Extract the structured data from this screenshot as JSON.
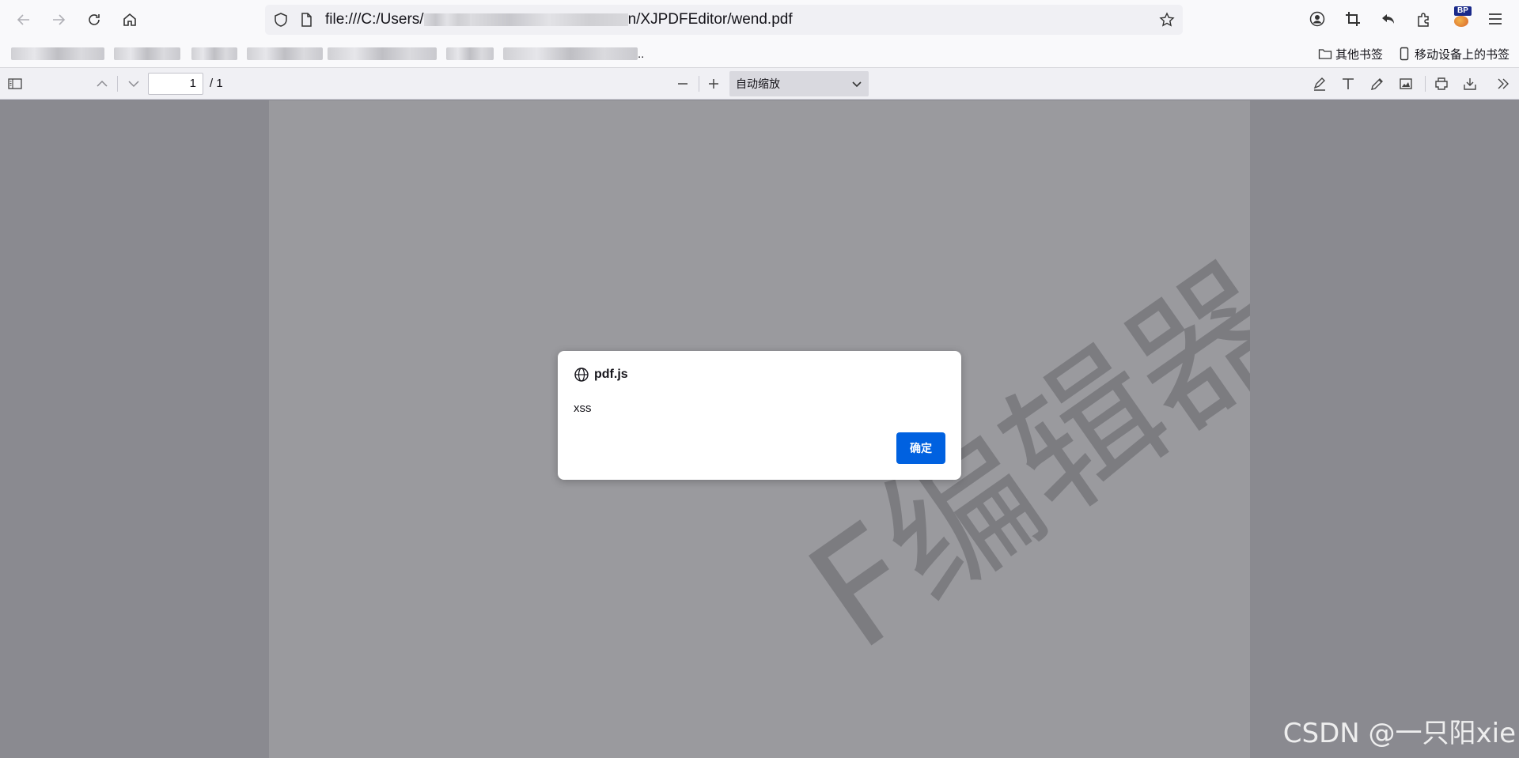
{
  "browser": {
    "url_prefix": "file:///C:/Users/",
    "url_suffix": "n/XJPDFEditor/wend.pdf",
    "bookmarks_other": "其他书签",
    "bookmarks_mobile": "移动设备上的书签",
    "bookmark_overflow": "..",
    "extension_badge": "BP"
  },
  "pdf_toolbar": {
    "page_number": "1",
    "page_total": "/ 1",
    "zoom_label": "自动缩放"
  },
  "document": {
    "watermark": "F编辑器"
  },
  "dialog": {
    "origin": "pdf.js",
    "message": "xss",
    "ok_label": "确定"
  },
  "overlay": {
    "credit": "CSDN @一只阳xie"
  },
  "colors": {
    "accent": "#0061e0",
    "viewer_bg": "#8a8a90",
    "page_bg": "#9a9a9e"
  }
}
